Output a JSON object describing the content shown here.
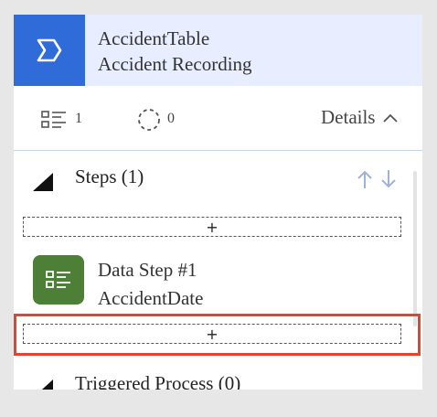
{
  "header": {
    "title": "AccidentTable",
    "subtitle": "Accident Recording",
    "icon": "chevron-badge-icon",
    "accent_color": "#2f6bd9"
  },
  "stats": {
    "steps_count": "1",
    "processes_count": "0",
    "details_label": "Details"
  },
  "steps_section": {
    "title": "Steps (1)",
    "add_symbol": "+",
    "steps": [
      {
        "name": "Data Step #1",
        "field": "AccidentDate",
        "icon": "data-step-icon",
        "color": "#4e7f36"
      }
    ]
  },
  "triggered_section": {
    "title": "Triggered Process (0)"
  },
  "highlight_color": "#e5432c"
}
